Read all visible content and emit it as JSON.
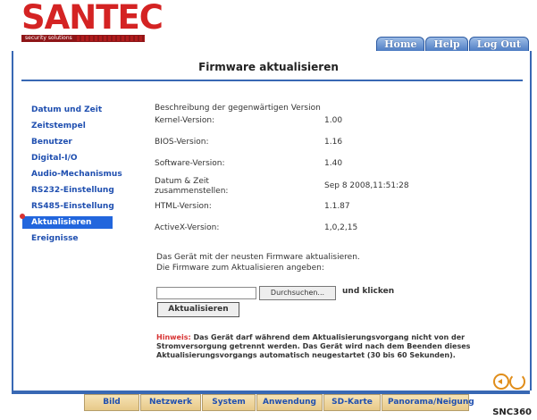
{
  "brand": {
    "name": "SANTEC",
    "tagline": "security solutions"
  },
  "topnav": {
    "items": [
      "Home",
      "Help",
      "Log Out"
    ]
  },
  "page": {
    "title": "Firmware aktualisieren"
  },
  "sidebar": {
    "items": [
      {
        "label": "Datum und Zeit"
      },
      {
        "label": "Zeitstempel"
      },
      {
        "label": "Benutzer"
      },
      {
        "label": "Digital-I/O"
      },
      {
        "label": "Audio-Mechanismus"
      },
      {
        "label": "RS232-Einstellung"
      },
      {
        "label": "RS485-Einstellung"
      },
      {
        "label": "Aktualisieren"
      },
      {
        "label": "Ereignisse"
      }
    ]
  },
  "content": {
    "heading": "Beschreibung der gegenwärtigen Version",
    "rows": [
      {
        "label": "Kernel-Version:",
        "value": "1.00"
      },
      {
        "label": "BIOS-Version:",
        "value": "1.16"
      },
      {
        "label": "Software-Version:",
        "value": "1.40"
      },
      {
        "label": "Datum & Zeit zusammenstellen:",
        "value": "Sep 8 2008,11:51:28"
      },
      {
        "label": "HTML-Version:",
        "value": "1.1.87"
      },
      {
        "label": "ActiveX-Version:",
        "value": "1,0,2,15"
      }
    ],
    "instruction_line1": "Das Gerät mit der neusten Firmware aktualisieren.",
    "instruction_line2": "Die Firmware zum Aktualisieren angeben:",
    "browse_label": "Durchsuchen...",
    "click_label": "und klicken",
    "update_button": "Aktualisieren",
    "hint_label": "Hinweis:",
    "hint_text": "Das Gerät darf während dem Aktualisierungsvorgang nicht von der Stromversorgung getrennt werden. Das Gerät wird nach dem Beenden dieses Aktualisierungsvorgangs automatisch neugestartet (30 bis 60 Sekunden)."
  },
  "bottom_tabs": [
    "Bild",
    "Netzwerk",
    "System",
    "Anwendung",
    "SD-Karte",
    "Panorama/Neigung"
  ],
  "model": "SNC360"
}
